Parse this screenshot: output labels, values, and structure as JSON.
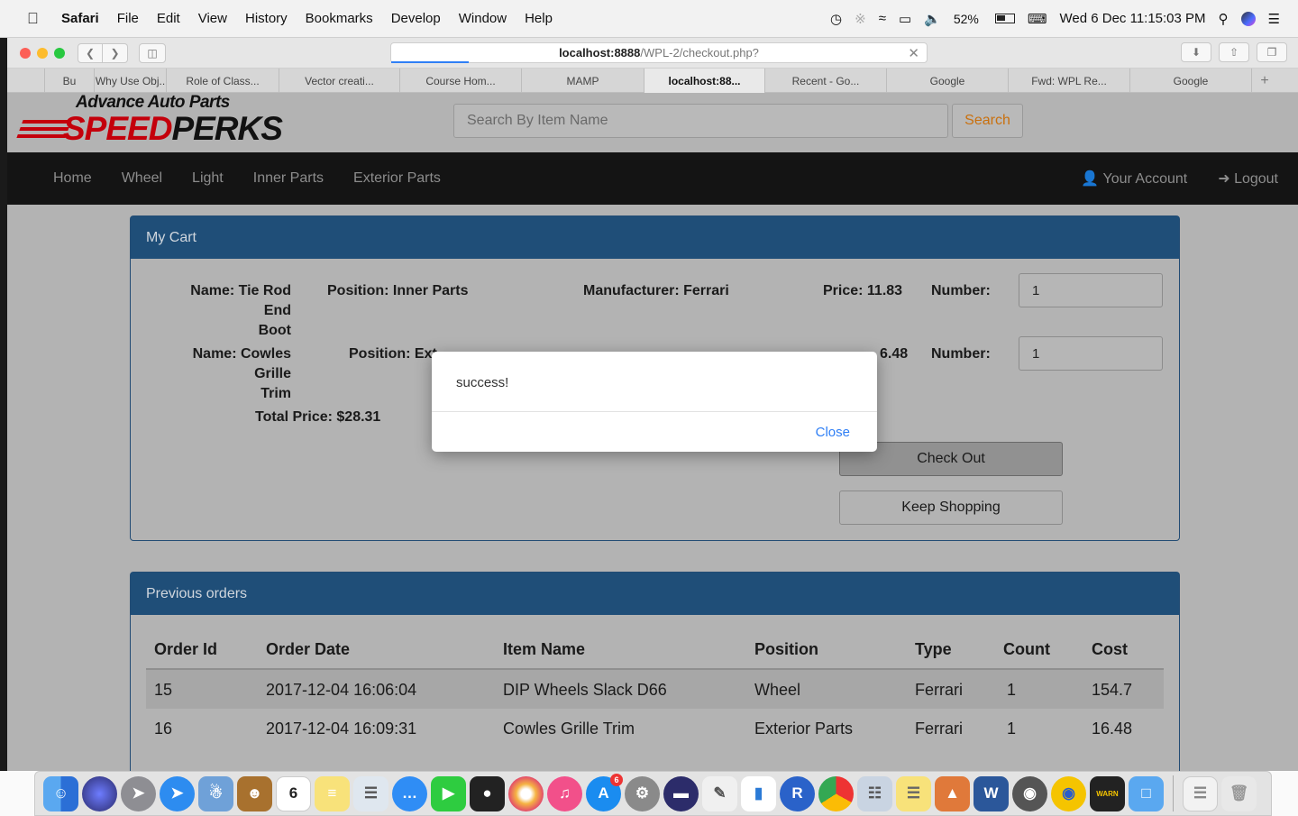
{
  "menubar": {
    "app": "Safari",
    "items": [
      "File",
      "Edit",
      "View",
      "History",
      "Bookmarks",
      "Develop",
      "Window",
      "Help"
    ],
    "battery": "52%",
    "clock": "Wed 6 Dec  11:15:03 PM"
  },
  "toolbar": {
    "url_host": "localhost:8888",
    "url_path": "/WPL-2/checkout.php?"
  },
  "tabs": [
    "Bu",
    "Why Use Obj..",
    "Role of Class...",
    "Vector creati...",
    "Course Hom...",
    "MAMP",
    "localhost:88...",
    "Recent - Go...",
    "Google",
    "Fwd: WPL Re...",
    "Google"
  ],
  "header": {
    "logo_top": "Advance Auto Parts",
    "logo_speed": "SPEED",
    "logo_perks": "PERKS",
    "search_placeholder": "Search By Item Name",
    "search_button": "Search"
  },
  "nav": {
    "items": [
      "Home",
      "Wheel",
      "Light",
      "Inner Parts",
      "Exterior Parts"
    ],
    "account": "Your Account",
    "logout": "Logout"
  },
  "cart": {
    "title": "My Cart",
    "items": [
      {
        "name_1": "Name: Tie Rod End",
        "name_2": "Boot",
        "position": "Position: Inner Parts",
        "manufacturer": "Manufacturer: Ferrari",
        "price": "Price: 11.83",
        "number_label": "Number:",
        "number": "1"
      },
      {
        "name_1": "Name: Cowles Grille",
        "name_2": "Trim",
        "position": "Position: Ext",
        "manufacturer": "",
        "price": "6.48",
        "number_label": "Number:",
        "number": "1"
      }
    ],
    "total": "Total Price: $28.31",
    "checkout": "Check Out",
    "keep_shopping": "Keep Shopping"
  },
  "orders": {
    "title": "Previous orders",
    "columns": [
      "Order Id",
      "Order Date",
      "Item Name",
      "Position",
      "Type",
      "Count",
      "Cost"
    ],
    "rows": [
      [
        "15",
        "2017-12-04 16:06:04",
        "DIP Wheels Slack D66",
        "Wheel",
        "Ferrari",
        "1",
        "154.7"
      ],
      [
        "16",
        "2017-12-04 16:09:31",
        "Cowles Grille Trim",
        "Exterior Parts",
        "Ferrari",
        "1",
        "16.48"
      ]
    ]
  },
  "dialog": {
    "message": "success!",
    "close": "Close"
  },
  "dock": {
    "calendar_day": "6",
    "appstore_badge": "6"
  }
}
